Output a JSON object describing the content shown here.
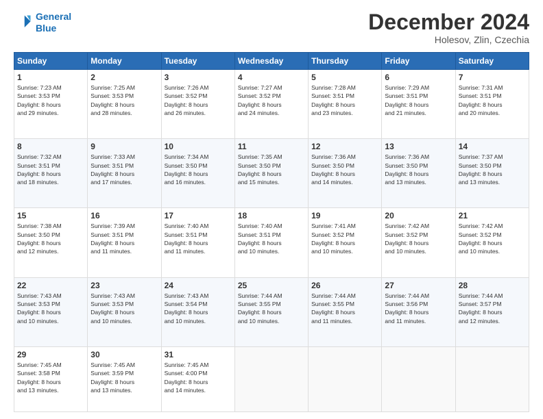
{
  "header": {
    "logo_line1": "General",
    "logo_line2": "Blue",
    "month_title": "December 2024",
    "location": "Holesov, Zlin, Czechia"
  },
  "days_of_week": [
    "Sunday",
    "Monday",
    "Tuesday",
    "Wednesday",
    "Thursday",
    "Friday",
    "Saturday"
  ],
  "weeks": [
    [
      {
        "day": "1",
        "info": "Sunrise: 7:23 AM\nSunset: 3:53 PM\nDaylight: 8 hours\nand 29 minutes."
      },
      {
        "day": "2",
        "info": "Sunrise: 7:25 AM\nSunset: 3:53 PM\nDaylight: 8 hours\nand 28 minutes."
      },
      {
        "day": "3",
        "info": "Sunrise: 7:26 AM\nSunset: 3:52 PM\nDaylight: 8 hours\nand 26 minutes."
      },
      {
        "day": "4",
        "info": "Sunrise: 7:27 AM\nSunset: 3:52 PM\nDaylight: 8 hours\nand 24 minutes."
      },
      {
        "day": "5",
        "info": "Sunrise: 7:28 AM\nSunset: 3:51 PM\nDaylight: 8 hours\nand 23 minutes."
      },
      {
        "day": "6",
        "info": "Sunrise: 7:29 AM\nSunset: 3:51 PM\nDaylight: 8 hours\nand 21 minutes."
      },
      {
        "day": "7",
        "info": "Sunrise: 7:31 AM\nSunset: 3:51 PM\nDaylight: 8 hours\nand 20 minutes."
      }
    ],
    [
      {
        "day": "8",
        "info": "Sunrise: 7:32 AM\nSunset: 3:51 PM\nDaylight: 8 hours\nand 18 minutes."
      },
      {
        "day": "9",
        "info": "Sunrise: 7:33 AM\nSunset: 3:51 PM\nDaylight: 8 hours\nand 17 minutes."
      },
      {
        "day": "10",
        "info": "Sunrise: 7:34 AM\nSunset: 3:50 PM\nDaylight: 8 hours\nand 16 minutes."
      },
      {
        "day": "11",
        "info": "Sunrise: 7:35 AM\nSunset: 3:50 PM\nDaylight: 8 hours\nand 15 minutes."
      },
      {
        "day": "12",
        "info": "Sunrise: 7:36 AM\nSunset: 3:50 PM\nDaylight: 8 hours\nand 14 minutes."
      },
      {
        "day": "13",
        "info": "Sunrise: 7:36 AM\nSunset: 3:50 PM\nDaylight: 8 hours\nand 13 minutes."
      },
      {
        "day": "14",
        "info": "Sunrise: 7:37 AM\nSunset: 3:50 PM\nDaylight: 8 hours\nand 13 minutes."
      }
    ],
    [
      {
        "day": "15",
        "info": "Sunrise: 7:38 AM\nSunset: 3:50 PM\nDaylight: 8 hours\nand 12 minutes."
      },
      {
        "day": "16",
        "info": "Sunrise: 7:39 AM\nSunset: 3:51 PM\nDaylight: 8 hours\nand 11 minutes."
      },
      {
        "day": "17",
        "info": "Sunrise: 7:40 AM\nSunset: 3:51 PM\nDaylight: 8 hours\nand 11 minutes."
      },
      {
        "day": "18",
        "info": "Sunrise: 7:40 AM\nSunset: 3:51 PM\nDaylight: 8 hours\nand 10 minutes."
      },
      {
        "day": "19",
        "info": "Sunrise: 7:41 AM\nSunset: 3:52 PM\nDaylight: 8 hours\nand 10 minutes."
      },
      {
        "day": "20",
        "info": "Sunrise: 7:42 AM\nSunset: 3:52 PM\nDaylight: 8 hours\nand 10 minutes."
      },
      {
        "day": "21",
        "info": "Sunrise: 7:42 AM\nSunset: 3:52 PM\nDaylight: 8 hours\nand 10 minutes."
      }
    ],
    [
      {
        "day": "22",
        "info": "Sunrise: 7:43 AM\nSunset: 3:53 PM\nDaylight: 8 hours\nand 10 minutes."
      },
      {
        "day": "23",
        "info": "Sunrise: 7:43 AM\nSunset: 3:53 PM\nDaylight: 8 hours\nand 10 minutes."
      },
      {
        "day": "24",
        "info": "Sunrise: 7:43 AM\nSunset: 3:54 PM\nDaylight: 8 hours\nand 10 minutes."
      },
      {
        "day": "25",
        "info": "Sunrise: 7:44 AM\nSunset: 3:55 PM\nDaylight: 8 hours\nand 10 minutes."
      },
      {
        "day": "26",
        "info": "Sunrise: 7:44 AM\nSunset: 3:55 PM\nDaylight: 8 hours\nand 11 minutes."
      },
      {
        "day": "27",
        "info": "Sunrise: 7:44 AM\nSunset: 3:56 PM\nDaylight: 8 hours\nand 11 minutes."
      },
      {
        "day": "28",
        "info": "Sunrise: 7:44 AM\nSunset: 3:57 PM\nDaylight: 8 hours\nand 12 minutes."
      }
    ],
    [
      {
        "day": "29",
        "info": "Sunrise: 7:45 AM\nSunset: 3:58 PM\nDaylight: 8 hours\nand 13 minutes."
      },
      {
        "day": "30",
        "info": "Sunrise: 7:45 AM\nSunset: 3:59 PM\nDaylight: 8 hours\nand 13 minutes."
      },
      {
        "day": "31",
        "info": "Sunrise: 7:45 AM\nSunset: 4:00 PM\nDaylight: 8 hours\nand 14 minutes."
      },
      {
        "day": "",
        "info": ""
      },
      {
        "day": "",
        "info": ""
      },
      {
        "day": "",
        "info": ""
      },
      {
        "day": "",
        "info": ""
      }
    ]
  ]
}
